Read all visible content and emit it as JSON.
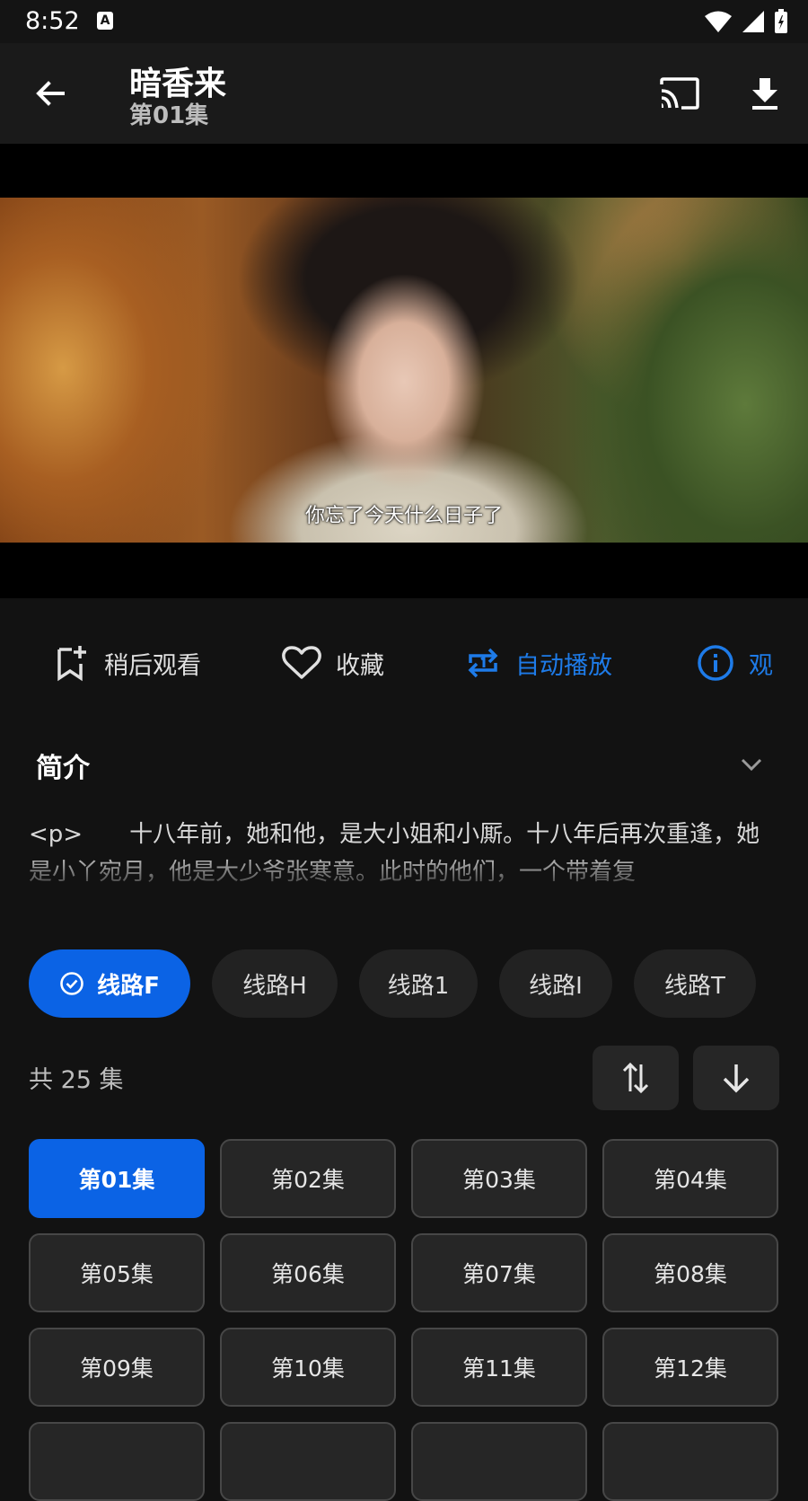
{
  "status_bar": {
    "time": "8:52",
    "notification_icon_letter": "A",
    "icons": [
      "wifi-icon",
      "cellular-signal-icon",
      "battery-icon"
    ]
  },
  "app_bar": {
    "title": "暗香来",
    "subtitle": "第01集",
    "icons": [
      "back-arrow-icon",
      "cast-icon",
      "download-icon"
    ]
  },
  "player": {
    "subtitle": "你忘了今天什么日子了"
  },
  "actions": [
    {
      "label": "稍后观看",
      "icon": "bookmark-add-icon",
      "active": false
    },
    {
      "label": "收藏",
      "icon": "heart-icon",
      "active": false
    },
    {
      "label": "自动播放",
      "icon": "repeat-one-icon",
      "active": true
    },
    {
      "label": "观",
      "icon": "info-icon",
      "active": true
    }
  ],
  "intro": {
    "heading": "简介",
    "text": "<p>　　十八年前，她和他，是大小姐和小厮。十八年后再次重逢，她是小丫宛月，他是大少爷张寒意。此时的他们，一个带着复"
  },
  "routes": [
    {
      "label": "线路F",
      "selected": true
    },
    {
      "label": "线路H",
      "selected": false
    },
    {
      "label": "线路1",
      "selected": false
    },
    {
      "label": "线路I",
      "selected": false
    },
    {
      "label": "线路T",
      "selected": false
    }
  ],
  "episodes_header": {
    "count_text": "共 25 集",
    "buttons": [
      "sort-toggle-icon",
      "arrow-down-icon"
    ]
  },
  "episodes": [
    "第01集",
    "第02集",
    "第03集",
    "第04集",
    "第05集",
    "第06集",
    "第07集",
    "第08集",
    "第09集",
    "第10集",
    "第11集",
    "第12集"
  ],
  "selected_episode_index": 0,
  "colors": {
    "accent": "#0b63e5",
    "active_text": "#1e7be8",
    "background": "#121212",
    "app_bar": "#1a1a1a"
  }
}
